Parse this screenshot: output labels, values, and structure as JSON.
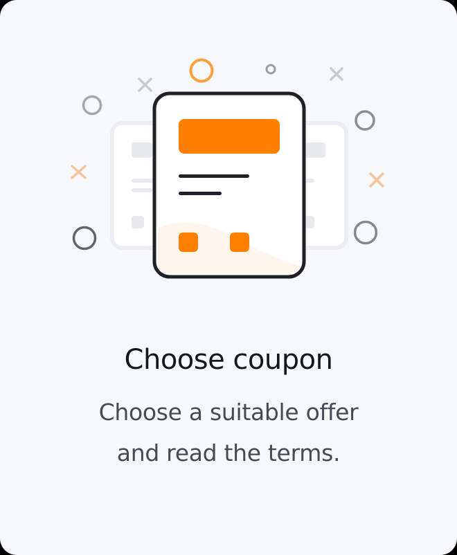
{
  "card": {
    "title": "Choose coupon",
    "description_line1": "Choose a suitable offer",
    "description_line2": "and read the terms."
  },
  "illustration": {
    "icon": "coupon-document-icon",
    "accent_color": "#ff8000",
    "outline_color": "#1f2126",
    "decoration_color": "#7b7d82"
  }
}
